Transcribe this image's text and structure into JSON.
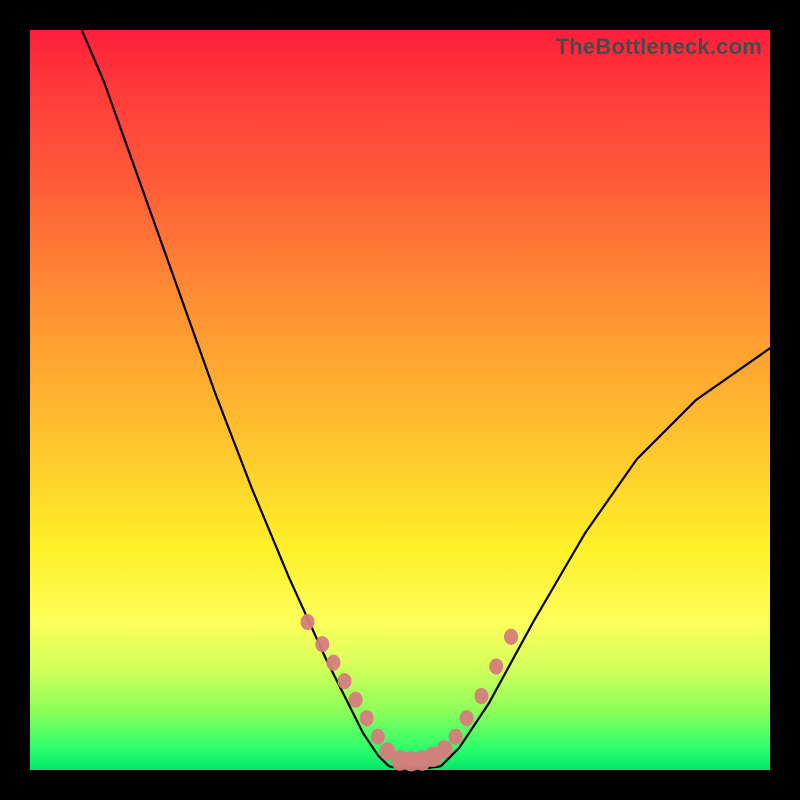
{
  "watermark": "TheBottleneck.com",
  "colors": {
    "gradient_top": "#ff1f3a",
    "gradient_mid1": "#ff8a34",
    "gradient_mid2": "#fff028",
    "gradient_bottom": "#00e96a",
    "curve": "#000000",
    "marker": "#d57d7d",
    "frame": "#000000"
  },
  "chart_data": {
    "type": "line",
    "title": "",
    "xlabel": "",
    "ylabel": "",
    "xlim": [
      0,
      100
    ],
    "ylim": [
      0,
      100
    ],
    "grid": false,
    "legend": false,
    "series": [
      {
        "name": "left-branch",
        "x": [
          7,
          10,
          15,
          20,
          25,
          30,
          35,
          40,
          43,
          45,
          47,
          48.5
        ],
        "values": [
          100,
          93,
          79,
          65,
          51,
          38,
          26,
          15,
          9,
          5,
          2,
          0.5
        ]
      },
      {
        "name": "floor",
        "x": [
          48.5,
          50,
          52,
          54,
          55.5
        ],
        "values": [
          0.5,
          0.2,
          0.2,
          0.3,
          0.5
        ]
      },
      {
        "name": "right-branch",
        "x": [
          55.5,
          58,
          62,
          68,
          75,
          82,
          90,
          100
        ],
        "values": [
          0.5,
          3,
          9,
          20,
          32,
          42,
          50,
          57
        ]
      }
    ],
    "markers": {
      "name": "highlight-dots",
      "x": [
        37.5,
        39.5,
        41,
        42.5,
        44,
        45.5,
        47,
        48.3,
        50,
        51.5,
        53,
        54.5,
        56,
        57.5,
        59,
        61,
        63,
        65
      ],
      "values": [
        20,
        17,
        14.5,
        12,
        9.5,
        7,
        4.5,
        2.5,
        1.3,
        1.2,
        1.3,
        1.8,
        2.8,
        4.5,
        7,
        10,
        14,
        18
      ],
      "r": [
        7,
        7,
        7,
        7,
        7,
        7,
        7,
        8,
        9,
        9,
        9,
        9,
        8,
        7,
        7,
        7,
        7,
        7
      ]
    }
  }
}
